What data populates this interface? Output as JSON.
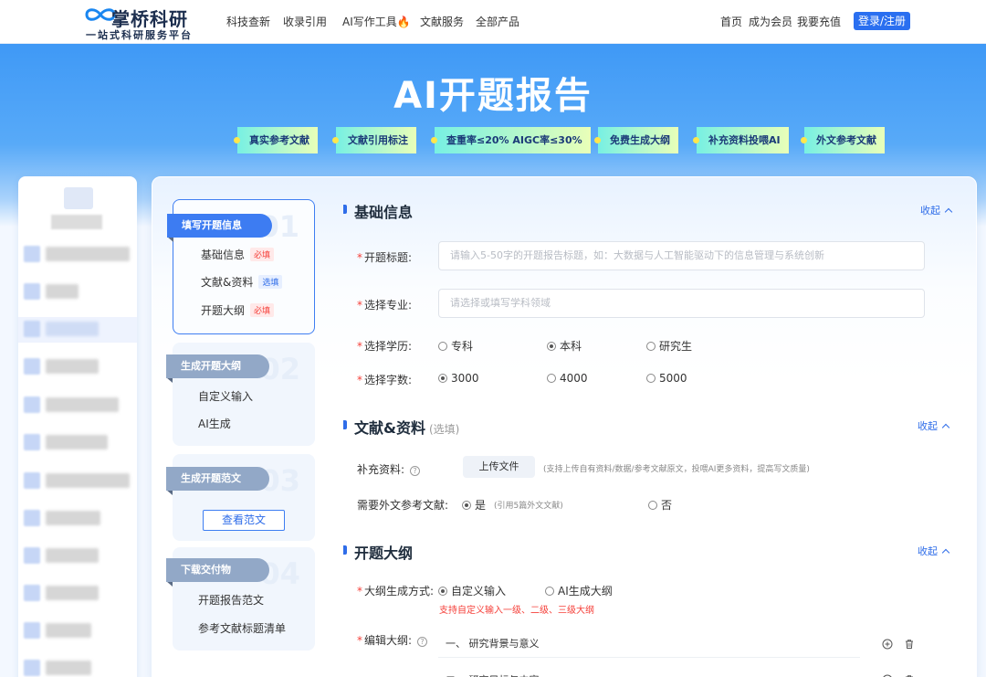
{
  "brand": {
    "name": "掌桥科研",
    "slogan": "一站式科研服务平台"
  },
  "topnav": {
    "links": [
      "科技查新",
      "收录引用",
      "AI写作工具",
      "文献服务",
      "全部产品"
    ],
    "right_links": [
      "首页",
      "成为会员",
      "我要充值"
    ],
    "login": "登录/注册",
    "fire_icon": "🔥"
  },
  "hero": {
    "title": "AI开题报告",
    "tags": [
      "真实参考文献",
      "文献引用标注",
      "查重率≤20%  AIGC率≤30%",
      "免费生成大纲",
      "补充资料投喂AI",
      "外文参考文献"
    ]
  },
  "steps": [
    {
      "num": "01",
      "title": "填写开题信息",
      "items": [
        {
          "label": "基础信息",
          "badge": "必填"
        },
        {
          "label": "文献&资料",
          "badge": "选填"
        },
        {
          "label": "开题大纲",
          "badge": "必填"
        }
      ]
    },
    {
      "num": "02",
      "title": "生成开题大纲",
      "items": [
        {
          "label": "自定义输入"
        },
        {
          "label": "AI生成"
        }
      ]
    },
    {
      "num": "03",
      "title": "生成开题范文",
      "button": "查看范文"
    },
    {
      "num": "04",
      "title": "下载交付物",
      "items": [
        {
          "label": "开题报告范文"
        },
        {
          "label": "参考文献标题清单"
        }
      ]
    }
  ],
  "form": {
    "collapse": "收起",
    "basic": {
      "title": "基础信息",
      "topic_label": "开题标题:",
      "topic_placeholder": "请输入5-50字的开题报告标题，如：大数据与人工智能驱动下的信息管理与系统创新",
      "major_label": "选择专业:",
      "major_placeholder": "请选择或填写学科领域",
      "degree_label": "选择学历:",
      "degree_options": [
        "专科",
        "本科",
        "研究生"
      ],
      "degree_selected": 1,
      "words_label": "选择字数:",
      "words_options": [
        "3000",
        "4000",
        "5000"
      ],
      "words_selected": 0
    },
    "refs": {
      "title": "文献&资料",
      "hint": "(选填)",
      "supplement_label": "补充资料:",
      "upload_button": "上传文件",
      "upload_hint": "(支持上传自有资料/数据/参考文献原文，投喂AI更多资料，提高写文质量)",
      "foreign_label": "需要外文参考文献:",
      "foreign_yes": "是",
      "foreign_yes_hint": "(引用5篇外文文献)",
      "foreign_no": "否",
      "foreign_selected": 0
    },
    "outline": {
      "title": "开题大纲",
      "mode_label": "大纲生成方式:",
      "mode_options": [
        "自定义输入",
        "AI生成大纲"
      ],
      "mode_selected": 0,
      "mode_hint": "支持自定义输入一级、二级、三级大纲",
      "edit_label": "编辑大纲:",
      "rows": [
        "一、  研究背景与意义",
        "二、  研究目标与内容"
      ]
    }
  },
  "colors": {
    "primary": "#2f6de9",
    "hero_top": "#3f99f6",
    "required": "#f5403a"
  }
}
